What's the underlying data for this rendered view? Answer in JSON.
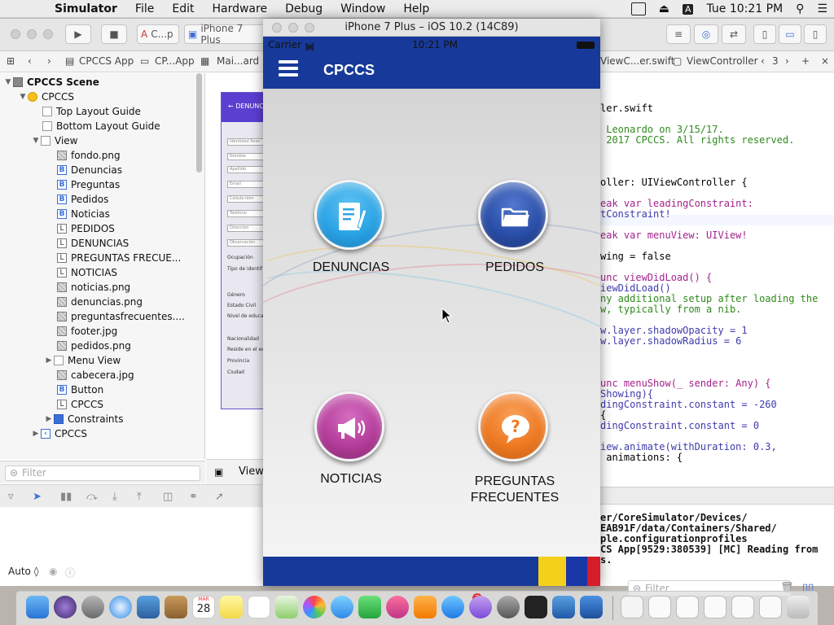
{
  "menubar": {
    "app_name": "Simulator",
    "items": [
      "File",
      "Edit",
      "Hardware",
      "Debug",
      "Window",
      "Help"
    ],
    "input_source": "A",
    "clock": "Tue 10:21 PM"
  },
  "xcode": {
    "scheme_short": "C...p",
    "destination": "iPhone 7 Plus",
    "jumpbar": {
      "project": "CPCCS App",
      "group": "CP...App",
      "file": "Mai...ard",
      "right_file": "ViewC...er.swift",
      "right_class": "ViewController",
      "counter": "3"
    },
    "navigator": {
      "rows": [
        {
          "label": "CPCCS Scene",
          "bold": true
        },
        {
          "label": "CPCCS"
        },
        {
          "label": "Top Layout Guide"
        },
        {
          "label": "Bottom Layout Guide"
        },
        {
          "label": "View"
        },
        {
          "label": "fondo.png"
        },
        {
          "label": "Denuncias"
        },
        {
          "label": "Preguntas"
        },
        {
          "label": "Pedidos"
        },
        {
          "label": "Noticias"
        },
        {
          "label": "PEDIDOS"
        },
        {
          "label": "DENUNCIAS"
        },
        {
          "label": "PREGUNTAS FRECUE..."
        },
        {
          "label": "NOTICIAS"
        },
        {
          "label": "noticias.png"
        },
        {
          "label": "denuncias.png"
        },
        {
          "label": "preguntasfrecuentes...."
        },
        {
          "label": "footer.jpg"
        },
        {
          "label": "pedidos.png"
        },
        {
          "label": "Menu View"
        },
        {
          "label": "cabecera.jpg"
        },
        {
          "label": "Button"
        },
        {
          "label": "CPCCS"
        },
        {
          "label": "Constraints"
        },
        {
          "label": "CPCCS"
        }
      ],
      "filter_placeholder": "Filter"
    },
    "canvas": {
      "preview_header": "DENUNCI",
      "preview_fields": [
        "Identidad Rese",
        "Nombre",
        "Apellido",
        "Email",
        "Cédula Iden",
        "Teléfono",
        "Dirección",
        "Observación"
      ],
      "preview_labels": [
        "Ocupación",
        "Tipo de identif",
        "Género",
        "Estado Civil",
        "Nivel de educa",
        "Nacionalidad",
        "Reside en el ex",
        "Provincia",
        "Ciudad"
      ],
      "view_as": "View"
    },
    "debug_bar": {
      "auto": "Auto ◊",
      "console_filter_placeholder": "Filter"
    },
    "code_lines": [
      {
        "t": "ler.swift",
        "c": ""
      },
      {
        "t": "",
        "c": ""
      },
      {
        "t": " Leonardo on 3/15/17.",
        "c": "cm"
      },
      {
        "t": " 2017 CPCCS. All rights reserved.",
        "c": "cm"
      },
      {
        "t": "",
        "c": ""
      },
      {
        "t": "",
        "c": ""
      },
      {
        "t": "",
        "c": ""
      },
      {
        "t": "oller: UIViewController {",
        "c": ""
      },
      {
        "t": "",
        "c": ""
      },
      {
        "t": "eak var leadingConstraint:",
        "c": "kw"
      },
      {
        "t": "tConstraint!",
        "c": "ty"
      },
      {
        "t": "",
        "c": ""
      },
      {
        "t": "eak var menuView: UIView!",
        "c": "kw"
      },
      {
        "t": "",
        "c": ""
      },
      {
        "t": "wing = false",
        "c": ""
      },
      {
        "t": "",
        "c": ""
      },
      {
        "t": "unc viewDidLoad() {",
        "c": "kw"
      },
      {
        "t": "iewDidLoad()",
        "c": "ty"
      },
      {
        "t": "ny additional setup after loading the",
        "c": "cm"
      },
      {
        "t": "w, typically from a nib.",
        "c": "cm"
      },
      {
        "t": "",
        "c": ""
      },
      {
        "t": "w.layer.shadowOpacity = 1",
        "c": "ty"
      },
      {
        "t": "w.layer.shadowRadius = 6",
        "c": "ty"
      },
      {
        "t": "",
        "c": ""
      },
      {
        "t": "",
        "c": ""
      },
      {
        "t": "",
        "c": ""
      },
      {
        "t": "unc menuShow(_ sender: Any) {",
        "c": "kw"
      },
      {
        "t": "Showing){",
        "c": "ty"
      },
      {
        "t": "dingConstraint.constant = -260",
        "c": "ty"
      },
      {
        "t": "{",
        "c": ""
      },
      {
        "t": "dingConstraint.constant = 0",
        "c": "ty"
      },
      {
        "t": "",
        "c": ""
      },
      {
        "t": "iew.animate(withDuration: 0.3,",
        "c": "ty"
      },
      {
        "t": " animations: {",
        "c": ""
      }
    ],
    "console_lines": [
      "er/CoreSimulator/Devices/",
      "EAB91F/data/Containers/Shared/",
      "ple.configurationprofiles",
      "CS App[9529:380539] [MC] Reading from",
      "s."
    ]
  },
  "simulator": {
    "window_title": "iPhone 7 Plus – iOS 10.2 (14C89)",
    "status": {
      "carrier": "Carrier",
      "time": "10:21 PM"
    },
    "app_title": "CPCCS",
    "tiles": [
      {
        "label": "DENUNCIAS",
        "icon": "document-pencil-icon",
        "color": "#2aa3e4"
      },
      {
        "label": "PEDIDOS",
        "icon": "folder-icon",
        "color": "#2a4fa8"
      },
      {
        "label": "NOTICIAS",
        "icon": "megaphone-icon",
        "color": "#b53d9b"
      },
      {
        "label": "PREGUNTAS\nFRECUENTES",
        "icon": "question-bubble-icon",
        "color": "#ee7a22"
      }
    ],
    "colors": {
      "bar": "#173a9a",
      "flag_yellow": "#f4d01a",
      "flag_red": "#d71c2a"
    }
  },
  "dock": {
    "calendar_month": "MAR",
    "calendar_day": "28",
    "appstore_badge": "2"
  }
}
